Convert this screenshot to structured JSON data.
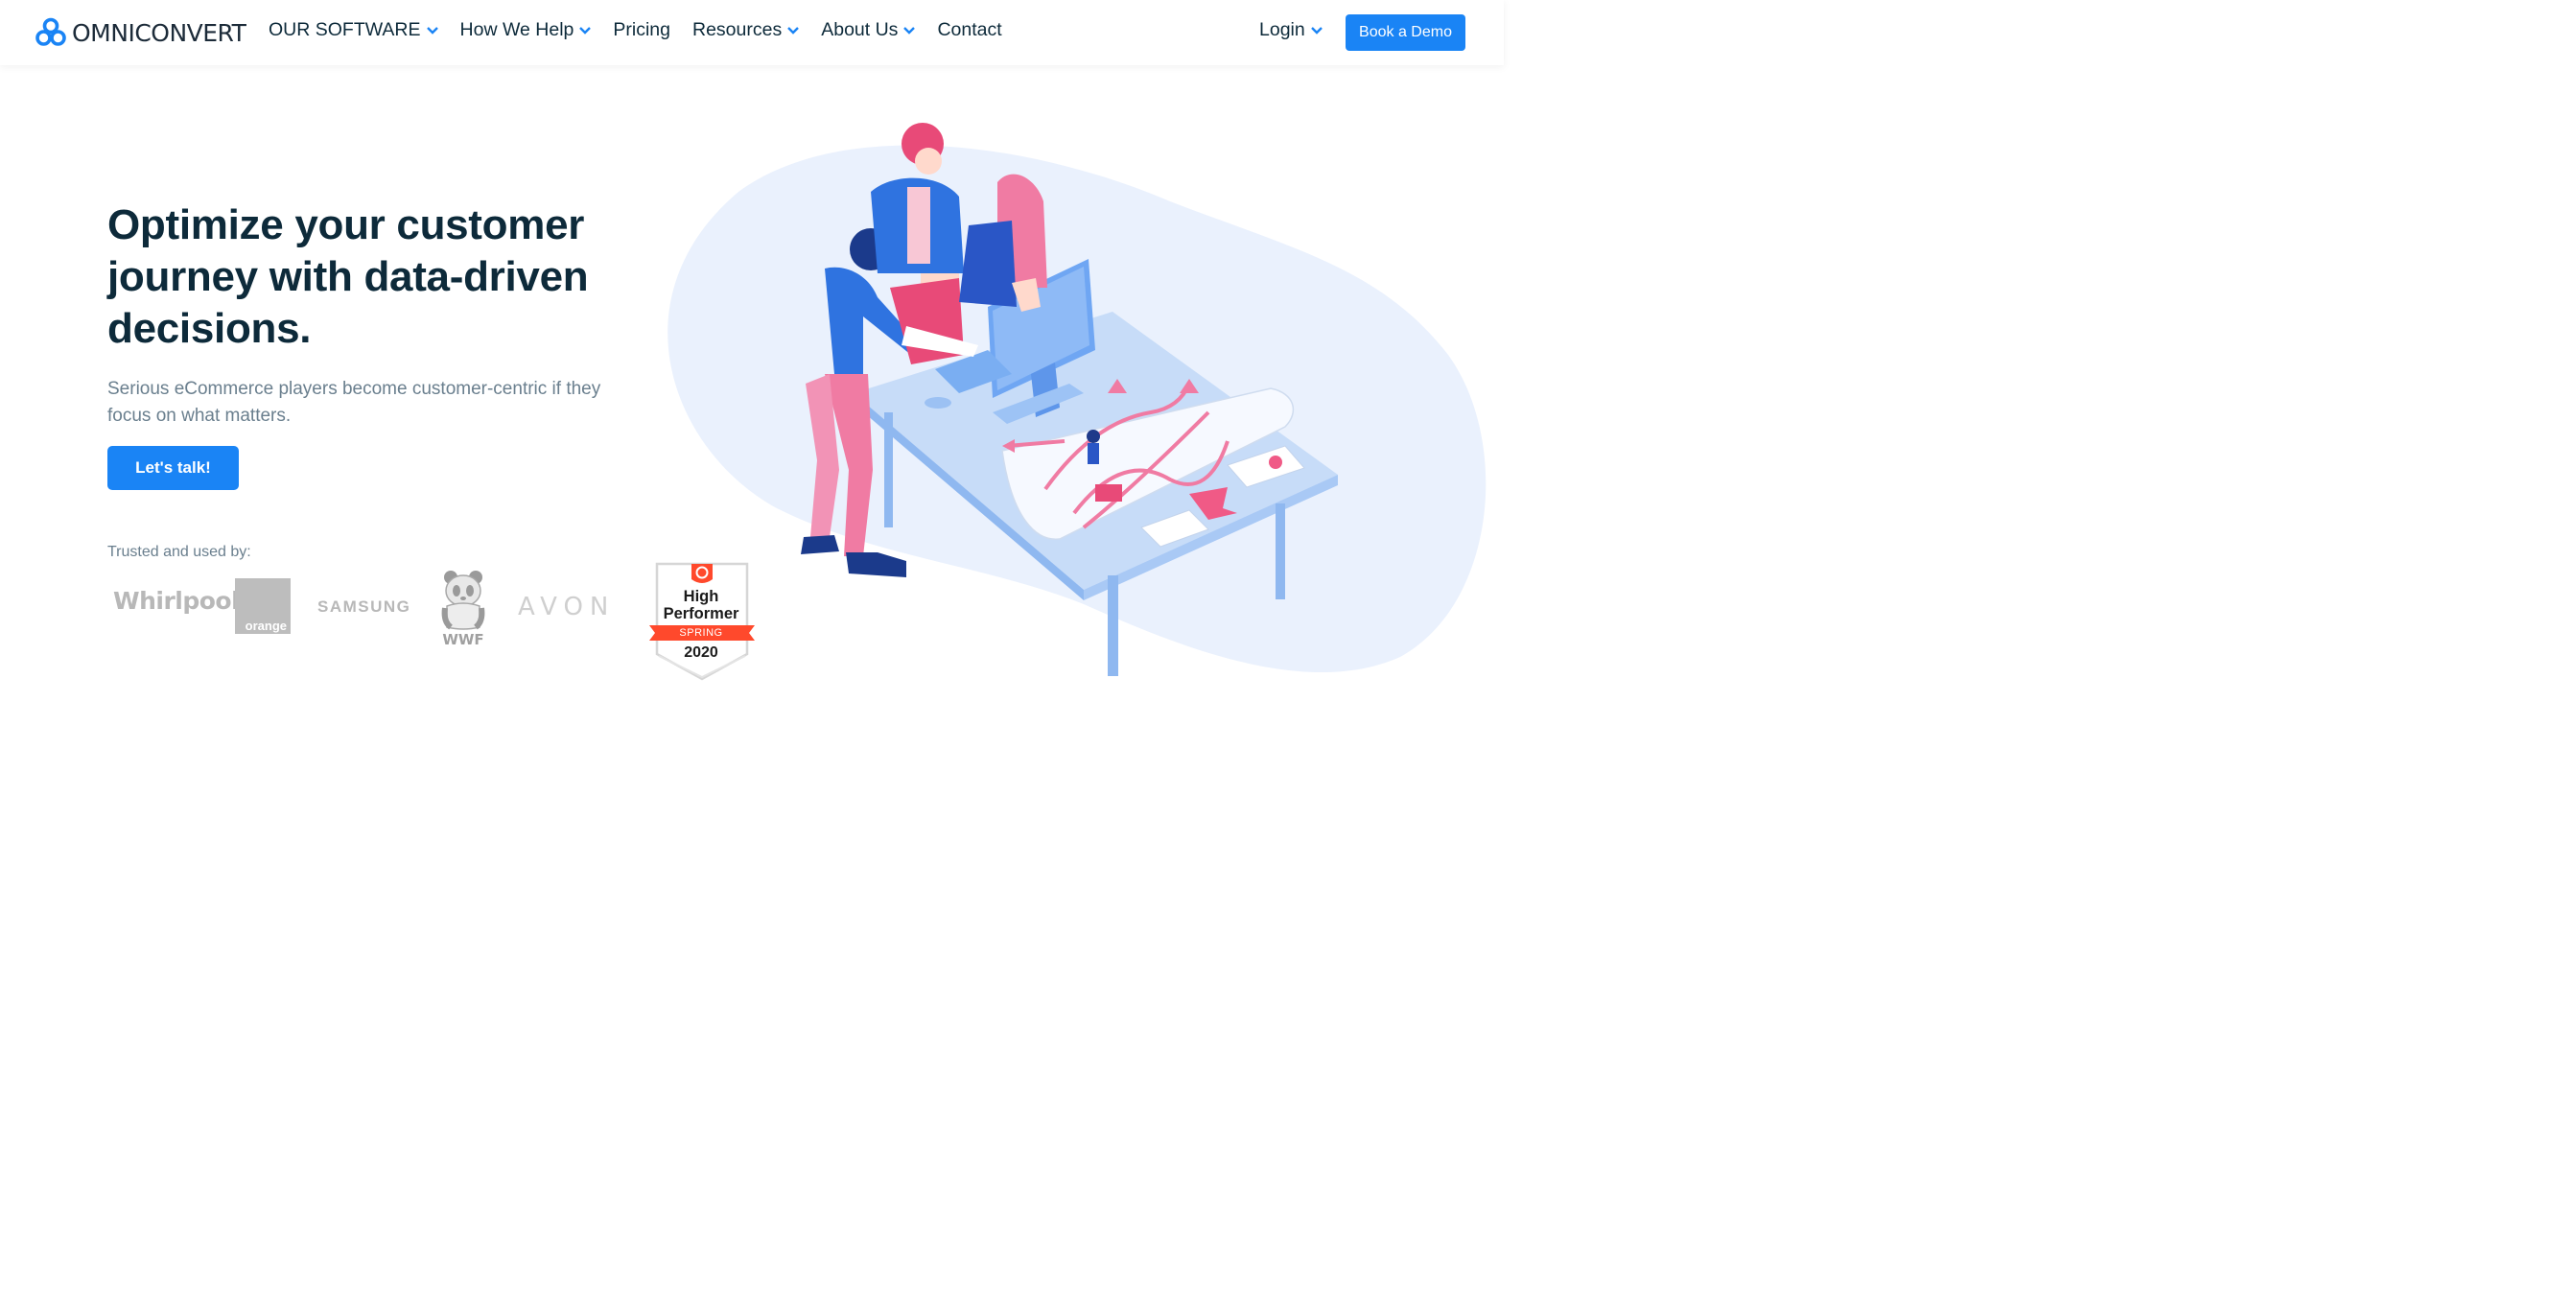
{
  "nav": {
    "brand": "OMNICONVERT",
    "items": [
      {
        "label": "OUR SOFTWARE",
        "dropdown": true
      },
      {
        "label": "How We Help",
        "dropdown": true
      },
      {
        "label": "Pricing",
        "dropdown": false
      },
      {
        "label": "Resources",
        "dropdown": true
      },
      {
        "label": "About Us",
        "dropdown": true
      },
      {
        "label": "Contact",
        "dropdown": false
      }
    ],
    "login": "Login",
    "demo": "Book a Demo"
  },
  "hero": {
    "headline": "Optimize your customer journey with data-driven decisions.",
    "subtext": "Serious eCommerce players become customer-centric if they focus on what matters.",
    "cta": "Let's talk!",
    "trusted_label": "Trusted and used by:"
  },
  "logos": {
    "whirlpool": "Whirlpool",
    "orange": "orange",
    "samsung": "SAMSUNG",
    "wwf": "WWF",
    "avon": "AVON"
  },
  "badge": {
    "line1": "High",
    "line2": "Performer",
    "season": "SPRING",
    "year": "2020"
  },
  "colors": {
    "accent": "#1a84f5",
    "heading": "#0d2a3a",
    "muted": "#6a7f8e",
    "badge_red": "#ff492c"
  }
}
